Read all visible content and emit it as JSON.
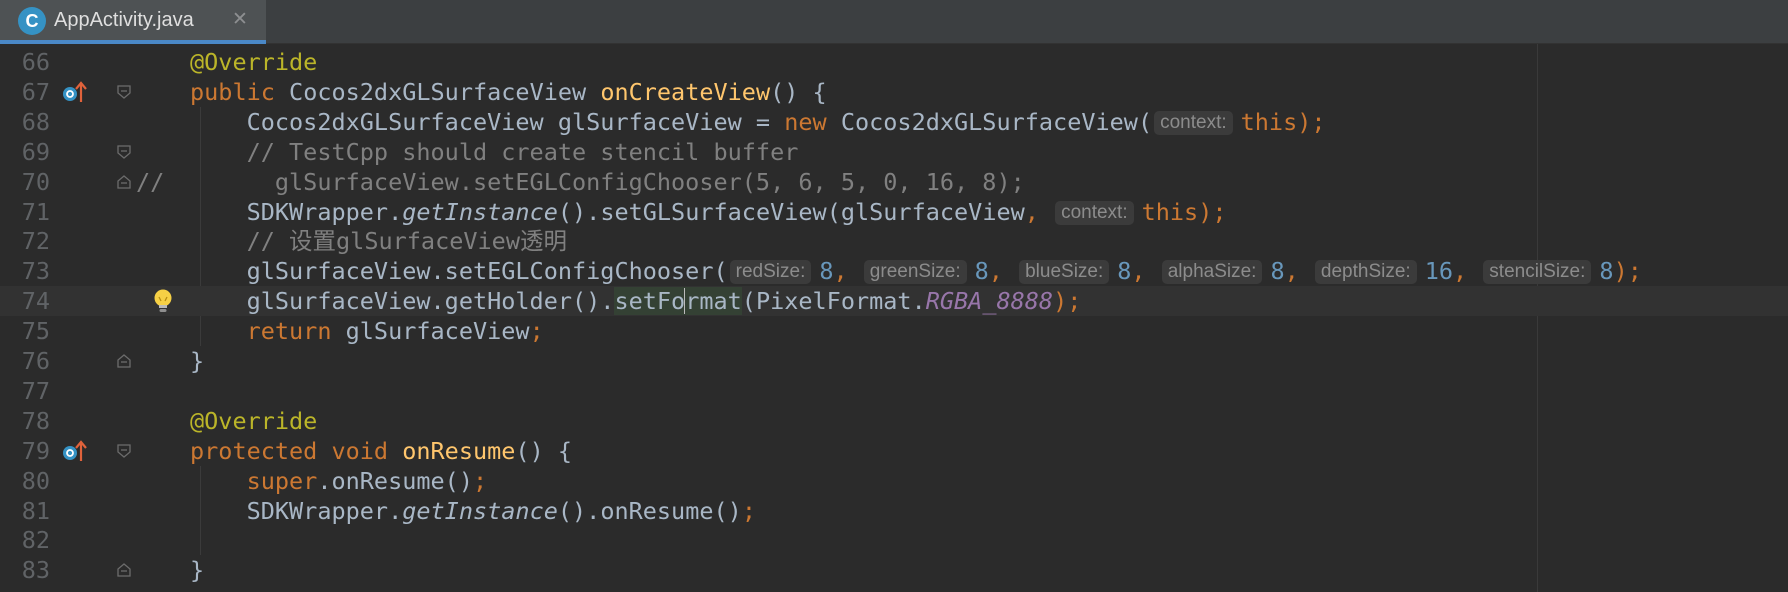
{
  "tab": {
    "icon_letter": "C",
    "filename": "AppActivity.java",
    "close": "✕"
  },
  "lines": [
    {
      "num": "66",
      "code": [
        {
          "t": "@Override",
          "c": "a"
        }
      ]
    },
    {
      "num": "67",
      "code": [
        {
          "t": "public ",
          "c": "k"
        },
        {
          "t": "Cocos2dxGLSurfaceView "
        },
        {
          "t": "onCreateView",
          "c": "f"
        },
        {
          "t": "() {"
        }
      ]
    },
    {
      "num": "68",
      "code": [
        {
          "t": "    Cocos2dxGLSurfaceView glSurfaceView = "
        },
        {
          "t": "new ",
          "c": "k"
        },
        {
          "t": "Cocos2dxGLSurfaceView("
        },
        {
          "t": "context:",
          "c": "hint"
        },
        {
          "t": "this",
          "c": "k"
        },
        {
          "t": ");",
          "c": "k"
        }
      ]
    },
    {
      "num": "69",
      "code": [
        {
          "t": "    // TestCpp should create stencil buffer",
          "c": "c"
        }
      ]
    },
    {
      "num": "70",
      "prefix": "//",
      "code": [
        {
          "t": "      glSurfaceView.setEGLConfigChooser(5, 6, 5, 0, 16, 8);",
          "c": "c"
        }
      ]
    },
    {
      "num": "71",
      "code": [
        {
          "t": "    SDKWrapper."
        },
        {
          "t": "getInstance",
          "c": "i"
        },
        {
          "t": "().setGLSurfaceView(glSurfaceView"
        },
        {
          "t": ", ",
          "c": "k"
        },
        {
          "t": "context:",
          "c": "hint"
        },
        {
          "t": "this",
          "c": "k"
        },
        {
          "t": ");",
          "c": "k"
        }
      ]
    },
    {
      "num": "72",
      "code": [
        {
          "t": "    // 设置glSurfaceView透明",
          "c": "c"
        }
      ]
    },
    {
      "num": "73",
      "code": [
        {
          "t": "    glSurfaceView.setEGLConfigChooser("
        },
        {
          "t": "redSize:",
          "c": "hint"
        },
        {
          "t": "8",
          "c": "n"
        },
        {
          "t": ", ",
          "c": "k"
        },
        {
          "t": "greenSize:",
          "c": "hint"
        },
        {
          "t": "8",
          "c": "n"
        },
        {
          "t": ", ",
          "c": "k"
        },
        {
          "t": "blueSize:",
          "c": "hint"
        },
        {
          "t": "8",
          "c": "n"
        },
        {
          "t": ", ",
          "c": "k"
        },
        {
          "t": "alphaSize:",
          "c": "hint"
        },
        {
          "t": "8",
          "c": "n"
        },
        {
          "t": ", ",
          "c": "k"
        },
        {
          "t": "depthSize:",
          "c": "hint"
        },
        {
          "t": "16",
          "c": "n"
        },
        {
          "t": ", ",
          "c": "k"
        },
        {
          "t": "stencilSize:",
          "c": "hint"
        },
        {
          "t": "8",
          "c": "n"
        },
        {
          "t": ");",
          "c": "k"
        }
      ]
    },
    {
      "num": "74",
      "current": true,
      "code": [
        {
          "t": "    glSurfaceView.getHolder()."
        },
        {
          "t": "setFo",
          "c": "hl"
        },
        {
          "t": "",
          "c": "caret"
        },
        {
          "t": "rmat",
          "c": "hl"
        },
        {
          "t": "(PixelFormat."
        },
        {
          "t": "RGBA_8888",
          "c": "s"
        },
        {
          "t": ");",
          "c": "k"
        }
      ]
    },
    {
      "num": "75",
      "code": [
        {
          "t": "    "
        },
        {
          "t": "return ",
          "c": "k"
        },
        {
          "t": "glSurfaceView"
        },
        {
          "t": ";",
          "c": "k"
        }
      ]
    },
    {
      "num": "76",
      "code": [
        {
          "t": "}"
        }
      ]
    },
    {
      "num": "77",
      "code": []
    },
    {
      "num": "78",
      "code": [
        {
          "t": "@Override",
          "c": "a"
        }
      ]
    },
    {
      "num": "79",
      "code": [
        {
          "t": "protected ",
          "c": "k"
        },
        {
          "t": "void ",
          "c": "k"
        },
        {
          "t": "onResume",
          "c": "f"
        },
        {
          "t": "() {"
        }
      ]
    },
    {
      "num": "80",
      "code": [
        {
          "t": "    "
        },
        {
          "t": "super",
          "c": "k"
        },
        {
          "t": ".onResume()"
        },
        {
          "t": ";",
          "c": "k"
        }
      ]
    },
    {
      "num": "81",
      "code": [
        {
          "t": "    SDKWrapper."
        },
        {
          "t": "getInstance",
          "c": "i"
        },
        {
          "t": "().onResume()"
        },
        {
          "t": ";",
          "c": "k"
        }
      ]
    },
    {
      "num": "82",
      "code": []
    },
    {
      "num": "83",
      "code": [
        {
          "t": "}"
        }
      ]
    }
  ],
  "gutter": {
    "override_lines": [
      "67",
      "79"
    ],
    "fold_lines": [
      "67",
      "69",
      "70",
      "76",
      "79",
      "83"
    ],
    "intention_bulb_line": "74"
  },
  "colors": {
    "keyword": "#cc7832",
    "annotation": "#bbb529",
    "method_decl": "#ffc66d",
    "comment": "#808080",
    "number": "#6897bb",
    "static_field": "#9876aa",
    "text": "#a9b7c6",
    "background": "#2b2b2b"
  }
}
